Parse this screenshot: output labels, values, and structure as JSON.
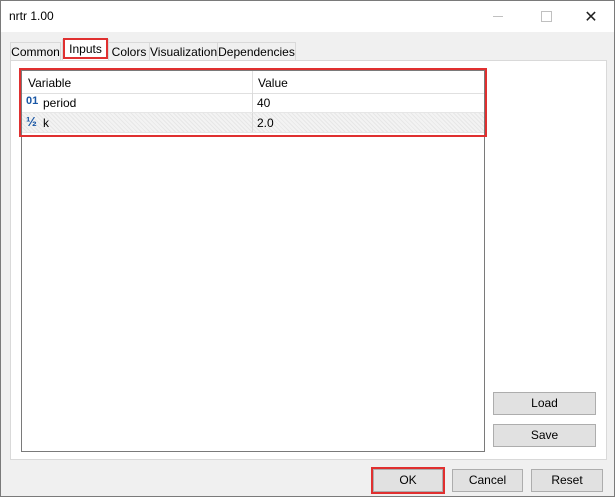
{
  "window": {
    "title": "nrtr 1.00",
    "close_glyph": "✕"
  },
  "tabs": [
    {
      "label": "Common"
    },
    {
      "label": "Inputs",
      "active": true
    },
    {
      "label": "Colors"
    },
    {
      "label": "Visualization"
    },
    {
      "label": "Dependencies"
    }
  ],
  "grid": {
    "col_variable": "Variable",
    "col_value": "Value",
    "rows": [
      {
        "icon": "integer-icon",
        "icon_glyph": "01",
        "name": "period",
        "value": "40"
      },
      {
        "icon": "fraction-icon",
        "icon_glyph": "½",
        "name": "k",
        "value": "2.0"
      }
    ]
  },
  "buttons": {
    "load": "Load",
    "save": "Save",
    "ok": "OK",
    "cancel": "Cancel",
    "reset": "Reset"
  },
  "highlight_color": "#e03030"
}
